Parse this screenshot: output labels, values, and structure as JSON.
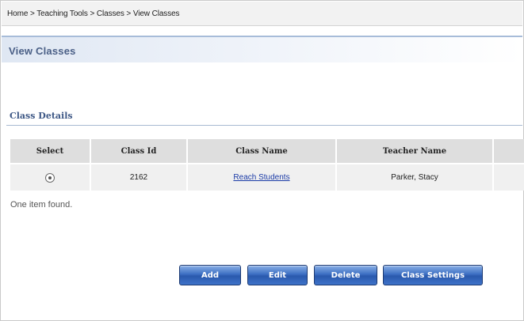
{
  "breadcrumb": "Home > Teaching Tools > Classes > View Classes",
  "page_title": "View Classes",
  "section_title": "Class Details",
  "table": {
    "headers": [
      "Select",
      "Class Id",
      "Class Name",
      "Teacher Name",
      ""
    ],
    "rows": [
      {
        "class_id": "2162",
        "class_name": "Reach Students",
        "teacher_name": "Parker, Stacy",
        "extra": ""
      }
    ]
  },
  "items_found": "One item found.",
  "buttons": {
    "add": "Add",
    "edit": "Edit",
    "delete": "Delete",
    "class_settings": "Class Settings"
  },
  "colors": {
    "title_text": "#4a5f86",
    "link": "#1a3aa6",
    "button_blue": "#2a59ad"
  }
}
